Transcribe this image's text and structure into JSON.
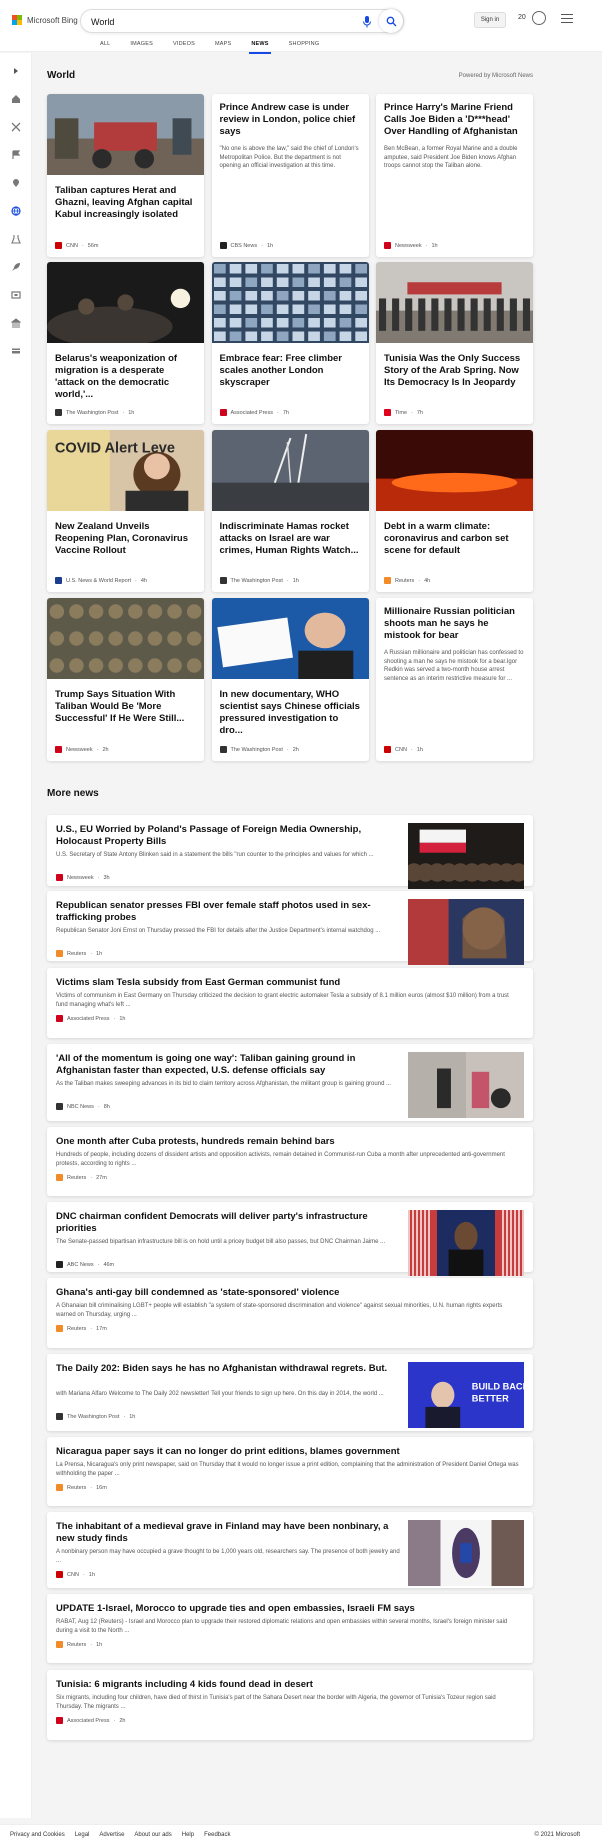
{
  "header": {
    "brand": "Microsoft Bing",
    "search_value": "World",
    "signin_label": "Sign in",
    "rewards_count": "20"
  },
  "tabs": [
    {
      "label": "ALL"
    },
    {
      "label": "IMAGES"
    },
    {
      "label": "VIDEOS"
    },
    {
      "label": "MAPS"
    },
    {
      "label": "NEWS",
      "active": true
    },
    {
      "label": "SHOPPING"
    }
  ],
  "section": {
    "title": "World",
    "powered": "Powered by Microsoft News"
  },
  "cards": [
    {
      "title": "Taliban captures Herat and Ghazni, leaving Afghan capital Kabul increasingly isolated",
      "source": "CNN",
      "time": "56m",
      "badge_color": "#cc0000",
      "image": "img-herat"
    },
    {
      "title": "Prince Andrew case is under review in London, police chief says",
      "desc": "\"No one is above the law,\" said the chief of London's Metropolitan Police. But the department is not opening an official investigation at this time.",
      "source": "CBS News",
      "time": "1h",
      "badge_color": "#222222"
    },
    {
      "title": "Prince Harry's Marine Friend Calls Joe Biden a 'D***head' Over Handling of Afghanistan",
      "desc": "Ben McBean, a former Royal Marine and a double amputee, said President Joe Biden knows Afghan troops cannot stop the Taliban alone.",
      "source": "Newsweek",
      "time": "1h",
      "badge_color": "#d0021b"
    },
    {
      "title": "Belarus's weaponization of migration is a desperate 'attack on the democratic world,'...",
      "source": "The Washington Post",
      "time": "1h",
      "badge_color": "#333333",
      "image": "img-belarus"
    },
    {
      "title": "Embrace fear: Free climber scales another London skyscraper",
      "source": "Associated Press",
      "time": "7h",
      "badge_color": "#d0021b",
      "image": "img-climber"
    },
    {
      "title": "Tunisia Was the Only Success Story of the Arab Spring. Now Its Democracy Is In Jeopardy",
      "source": "Time",
      "time": "7h",
      "badge_color": "#e0001b",
      "image": "img-tunisia"
    },
    {
      "title": "New Zealand Unveils Reopening Plan, Coronavirus Vaccine Rollout",
      "source": "U.S. News & World Report",
      "time": "4h",
      "badge_color": "#1a3e8c",
      "image": "img-nz",
      "image_text": "COVID Alert Leve"
    },
    {
      "title": "Indiscriminate Hamas rocket attacks on Israel are war crimes, Human Rights Watch...",
      "source": "The Washington Post",
      "time": "1h",
      "badge_color": "#333333",
      "image": "img-rockets"
    },
    {
      "title": "Debt in a warm climate: coronavirus and carbon set scene for default",
      "source": "Reuters",
      "time": "4h",
      "badge_color": "#f28c28",
      "image": "img-fire"
    },
    {
      "title": "Trump Says Situation With Taliban Would Be 'More Successful' If He Were Still...",
      "source": "Newsweek",
      "time": "2h",
      "badge_color": "#d0021b",
      "image": "img-troops"
    },
    {
      "title": "In new documentary, WHO scientist says Chinese officials pressured investigation to dro...",
      "source": "The Washington Post",
      "time": "2h",
      "badge_color": "#333333",
      "image": "img-who"
    },
    {
      "title": "Millionaire Russian politician shoots man he says he mistook for bear",
      "desc": "A Russian millionaire and politician has confessed to shooting a man he says he mistook for a bear.Igor Redkin was served a two-month house arrest sentence as an interim restrictive measure for ...",
      "source": "CNN",
      "time": "1h",
      "badge_color": "#cc0000"
    }
  ],
  "more_news": {
    "title": "More news",
    "items": [
      {
        "title": "U.S., EU Worried by Poland's Passage of Foreign Media Ownership, Holocaust Property Bills",
        "desc": "U.S. Secretary of State Antony Blinken said in a statement the bills \"run counter to the principles and values for which ...",
        "source": "Newsweek",
        "time": "3h",
        "badge_color": "#d0021b",
        "image": "img-poland"
      },
      {
        "title": "Republican senator presses FBI over female staff photos used in sex-trafficking probes",
        "desc": "Republican Senator Joni Ernst on Thursday pressed the FBI for details after the Justice Department's internal watchdog ...",
        "source": "Reuters",
        "time": "1h",
        "badge_color": "#f28c28",
        "image": "img-ernst"
      },
      {
        "title": "Victims slam Tesla subsidy from East German communist fund",
        "desc": "Victims of communism in East Germany on Thursday criticized the decision to grant electric automaker Tesla a subsidy of 8.1 million euros (almost $10 million) from a trust fund managing what's left ...",
        "source": "Associated Press",
        "time": "1h",
        "badge_color": "#d0021b"
      },
      {
        "title": "'All of the momentum is going one way': Taliban gaining ground in Afghanistan faster than expected, U.S. defense officials say",
        "desc": "As the Taliban makes sweeping advances in its bid to claim territory across Afghanistan, the militant group is gaining ground ...",
        "source": "NBC News",
        "time": "8h",
        "badge_color": "#333333",
        "image": "img-afghan"
      },
      {
        "title": "One month after Cuba protests, hundreds remain behind bars",
        "desc": "Hundreds of people, including dozens of dissident artists and opposition activists, remain detained in Communist-run Cuba a month after unprecedented anti-government protests, according to rights ...",
        "source": "Reuters",
        "time": "27m",
        "badge_color": "#f28c28"
      },
      {
        "title": "DNC chairman confident Democrats will deliver party's infrastructure priorities",
        "desc": "The Senate-passed bipartisan infrastructure bill is on hold until a pricey budget bill also passes, but DNC Chairman Jaime ...",
        "source": "ABC News",
        "time": "46m",
        "badge_color": "#222222",
        "image": "img-dnc"
      },
      {
        "title": "Ghana's anti-gay bill condemned as 'state-sponsored' violence",
        "desc": "A Ghanaian bill criminalising LGBT+ people will establish \"a system of state-sponsored discrimination and violence\" against sexual minorities, U.N. human rights experts warned on Thursday, urging ...",
        "source": "Reuters",
        "time": "17m",
        "badge_color": "#f28c28"
      },
      {
        "title": "The Daily 202: Biden says he has no Afghanistan withdrawal regrets. But.",
        "desc": "with Mariana Alfaro Welcome to The Daily 202 newsletter! Tell your friends to sign up here. On this day in 2014, the world ...",
        "source": "The Washington Post",
        "time": "1h",
        "badge_color": "#333333",
        "image": "img-biden",
        "image_text": "BUILD BACK BETTER"
      },
      {
        "title": "Nicaragua paper says it can no longer do print editions, blames government",
        "desc": "La Prensa, Nicaragua's only print newspaper, said on Thursday that it would no longer issue a print edition, complaining that the administration of President Daniel Ortega was withholding the paper ...",
        "source": "Reuters",
        "time": "16m",
        "badge_color": "#f28c28"
      },
      {
        "title": "The inhabitant of a medieval grave in Finland may have been nonbinary, a new study finds",
        "desc": "A nonbinary person may have occupied a grave thought to be 1,000 years old, researchers say. The presence of both jewelry and ...",
        "source": "CNN",
        "time": "1h",
        "badge_color": "#cc0000",
        "image": "img-grave"
      },
      {
        "title": "UPDATE 1-Israel, Morocco to upgrade ties and open embassies, Israeli FM says",
        "desc": "RABAT, Aug 12 (Reuters) - Israel and Morocco plan to upgrade their restored diplomatic relations and open embassies within several months, Israel's foreign minister said during a visit to the North ...",
        "source": "Reuters",
        "time": "1h",
        "badge_color": "#f28c28"
      },
      {
        "title": "Tunisia: 6 migrants including 4 kids found dead in desert",
        "desc": "Six migrants, including four children, have died of thirst in Tunisia's part of the Sahara Desert near the border with Algeria, the governor of Tunisia's Tozeur region said Thursday. The migrants ...",
        "source": "Associated Press",
        "time": "2h",
        "badge_color": "#d0021b"
      }
    ]
  },
  "footer": {
    "links": [
      "Privacy and Cookies",
      "Legal",
      "Advertise",
      "About our ads",
      "Help",
      "Feedback"
    ],
    "copyright": "© 2021 Microsoft"
  },
  "colors": {
    "accent": "#174ae4",
    "link": "#111111"
  }
}
